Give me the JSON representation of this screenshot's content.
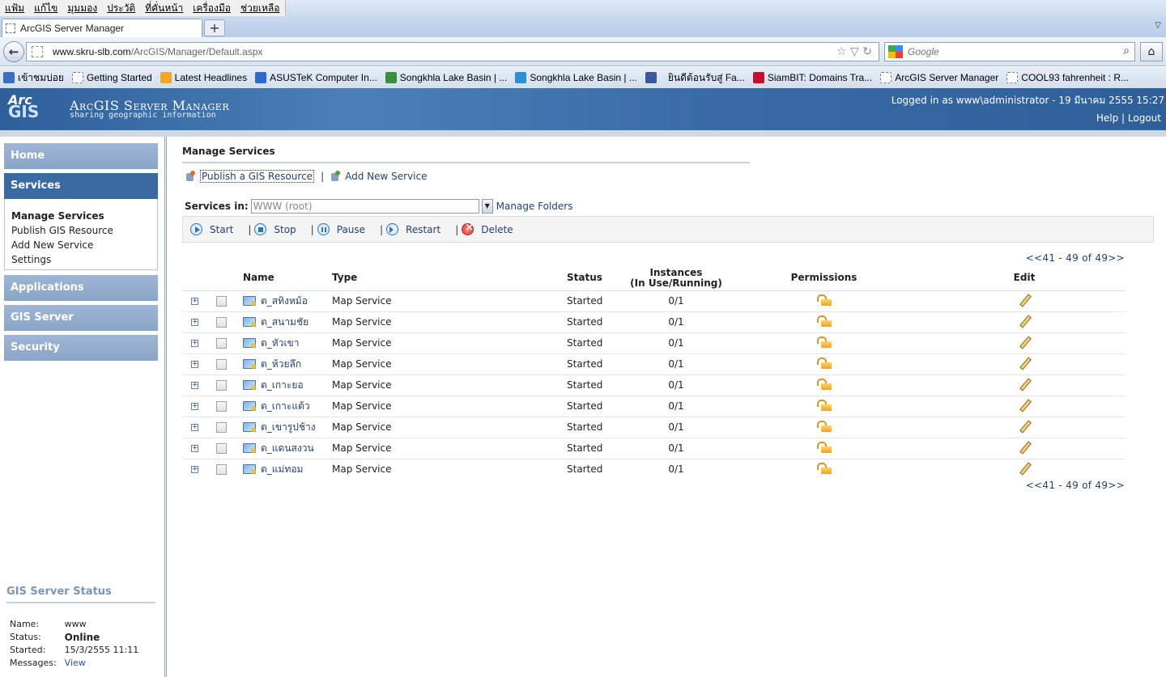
{
  "browser": {
    "menus": [
      "แฟ้ม",
      "แก้ไข",
      "มุมมอง",
      "ประวัติ",
      "ที่คั่นหน้า",
      "เครื่องมือ",
      "ช่วยเหลือ"
    ],
    "tab_title": "ArcGIS Server Manager",
    "new_tab": "+",
    "url_domain": "www.skru-slb.com",
    "url_path": "/ArcGIS/Manager/Default.aspx",
    "search_placeholder": "Google",
    "bookmarks": [
      {
        "label": "เข้าชมบ่อย",
        "icon": "bookmark-icon",
        "color": "#3b6fc4"
      },
      {
        "label": "Getting Started",
        "icon": "page-icon",
        "color": "#ffffff"
      },
      {
        "label": "Latest Headlines",
        "icon": "rss-icon",
        "color": "#f5a623"
      },
      {
        "label": "ASUSTeK Computer In...",
        "icon": "asus-icon",
        "color": "#2a6bd1"
      },
      {
        "label": "Songkhla Lake Basin | ...",
        "icon": "songkhla-icon",
        "color": "#3a8f3a"
      },
      {
        "label": "Songkhla Lake Basin | ...",
        "icon": "water-icon",
        "color": "#2b8fd8"
      },
      {
        "label": "",
        "icon": "facebook-icon",
        "color": "#3b5998"
      },
      {
        "label": "ยินดีต้อนรับสู่ Fa...",
        "icon": "none",
        "color": ""
      },
      {
        "label": "SiamBIT: Domains Tra...",
        "icon": "thai-flag-icon",
        "color": "#c8102e"
      },
      {
        "label": "ArcGIS Server Manager",
        "icon": "page-icon",
        "color": "#ffffff"
      },
      {
        "label": "COOL93 fahrenheit : R...",
        "icon": "page-icon",
        "color": "#ffffff"
      }
    ]
  },
  "header": {
    "logo_arc": "Arc",
    "logo_gis": "GIS",
    "title": "ArcGIS Server Manager",
    "subtitle": "sharing geographic information",
    "login_info": "Logged in as www\\administrator - 19 มีนาคม 2555 15:27",
    "help": "Help",
    "logout": "Logout",
    "link_sep": "|"
  },
  "sidebar": {
    "home": "Home",
    "services": "Services",
    "sub_items": [
      "Manage Services",
      "Publish GIS Resource",
      "Add New Service",
      "Settings"
    ],
    "applications": "Applications",
    "gis_server": "GIS Server",
    "security": "Security",
    "status": {
      "heading": "GIS Server Status",
      "name_label": "Name:",
      "name_value": "www",
      "status_label": "Status:",
      "status_value": "Online",
      "started_label": "Started:",
      "started_value": "15/3/2555 11:11",
      "messages_label": "Messages:",
      "messages_value": "View"
    }
  },
  "main": {
    "title": "Manage Services",
    "publish": "Publish a GIS Resource",
    "add_new": "Add New Service",
    "sep": "|",
    "services_in_label": "Services in:",
    "folder_value": "WWW (root)",
    "manage_folders": "Manage Folders",
    "toolbar": {
      "start": "Start",
      "stop": "Stop",
      "pause": "Pause",
      "restart": "Restart",
      "delete": "Delete",
      "sep": "|"
    },
    "pager": "<<41 - 49 of 49>>",
    "columns": {
      "name": "Name",
      "type": "Type",
      "status": "Status",
      "instances_1": "Instances",
      "instances_2": "(In Use/Running)",
      "permissions": "Permissions",
      "edit": "Edit"
    },
    "rows": [
      {
        "name": "ต_สทิงหม้อ",
        "type": "Map Service",
        "status": "Started",
        "instances": "0/1"
      },
      {
        "name": "ต_สนามชัย",
        "type": "Map Service",
        "status": "Started",
        "instances": "0/1"
      },
      {
        "name": "ต_หัวเขา",
        "type": "Map Service",
        "status": "Started",
        "instances": "0/1"
      },
      {
        "name": "ต_ห้วยลึก",
        "type": "Map Service",
        "status": "Started",
        "instances": "0/1"
      },
      {
        "name": "ต_เกาะยอ",
        "type": "Map Service",
        "status": "Started",
        "instances": "0/1"
      },
      {
        "name": "ต_เกาะแต้ว",
        "type": "Map Service",
        "status": "Started",
        "instances": "0/1"
      },
      {
        "name": "ต_เขารูปช้าง",
        "type": "Map Service",
        "status": "Started",
        "instances": "0/1"
      },
      {
        "name": "ต_แดนสงวน",
        "type": "Map Service",
        "status": "Started",
        "instances": "0/1"
      },
      {
        "name": "ต_แม่ทอม",
        "type": "Map Service",
        "status": "Started",
        "instances": "0/1"
      }
    ]
  }
}
